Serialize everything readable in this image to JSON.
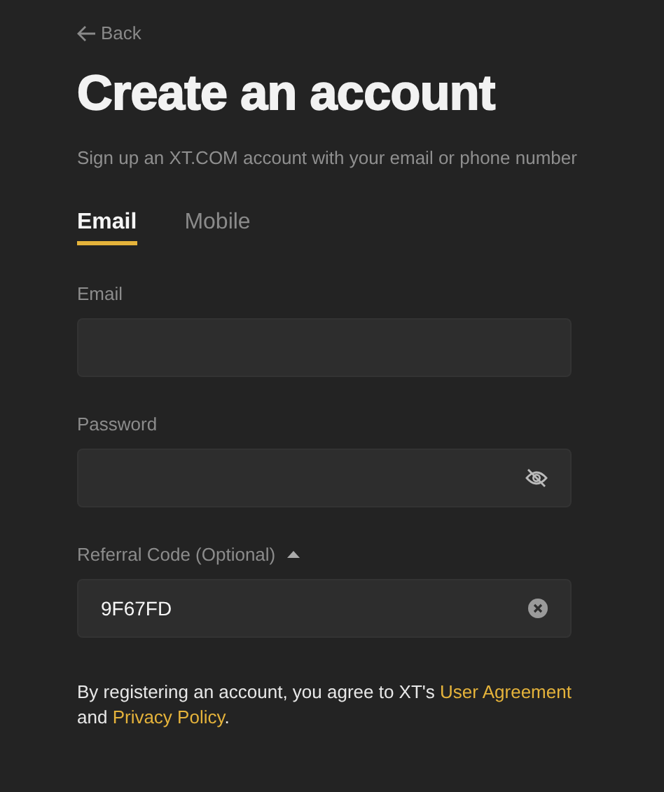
{
  "back": {
    "label": "Back"
  },
  "title": "Create an account",
  "subtitle": "Sign up an XT.COM account with your email or phone number",
  "tabs": [
    {
      "label": "Email",
      "selected": true
    },
    {
      "label": "Mobile",
      "selected": false
    }
  ],
  "fields": [
    {
      "kind": "text",
      "label": "Email"
    },
    {
      "kind": "password",
      "label": "Password"
    },
    {
      "kind": "referral",
      "label": "Referral Code (Optional)",
      "expanded": true,
      "value": "9F67FD"
    }
  ],
  "agreement": [
    {
      "kind": "text",
      "text": "By registering an account, you agree to XT's "
    },
    {
      "kind": "link",
      "text": "User Agreement"
    },
    {
      "kind": "text",
      "text": " and "
    },
    {
      "kind": "link",
      "text": "Privacy Policy"
    },
    {
      "kind": "text",
      "text": "."
    }
  ]
}
